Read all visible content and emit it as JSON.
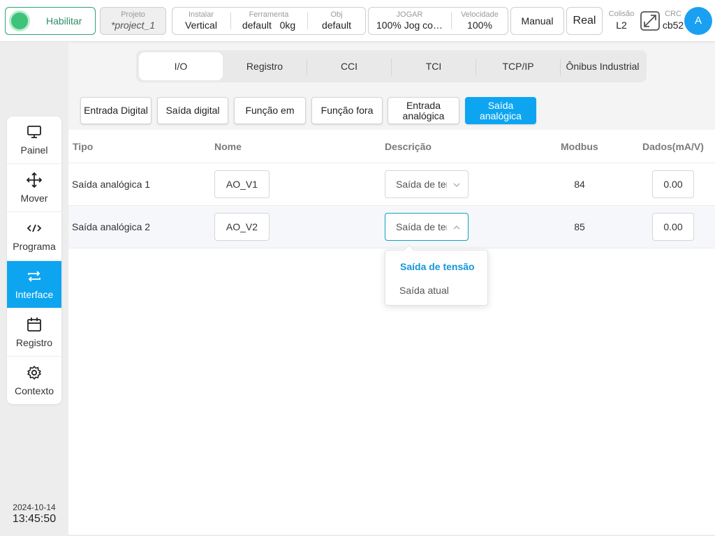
{
  "topbar": {
    "enable_label": "Habilitar",
    "project": {
      "label": "Projeto",
      "value": "*project_1"
    },
    "install": {
      "label": "Instalar",
      "value": "Vertical"
    },
    "tool": {
      "label": "Ferramenta",
      "value": "default",
      "weight": "0kg"
    },
    "obj": {
      "label": "Obj",
      "value": "default"
    },
    "jog": {
      "label": "JOGAR",
      "value": "100%  Jog co…"
    },
    "speed": {
      "label": "Velocidade",
      "value": "100%"
    },
    "manual_label": "Manual",
    "real_label": "Real",
    "collision": {
      "label": "Colisão",
      "value": "L2"
    },
    "crc": {
      "label": "CRC",
      "value": "cb52"
    },
    "avatar": "A"
  },
  "sidebar": {
    "items": [
      {
        "label": "Painel",
        "icon": "monitor-icon"
      },
      {
        "label": "Mover",
        "icon": "move-arrows-icon"
      },
      {
        "label": "Programa",
        "icon": "code-icon"
      },
      {
        "label": "Interface",
        "icon": "swap-arrows-icon",
        "active": true
      },
      {
        "label": "Registro",
        "icon": "calendar-icon"
      },
      {
        "label": "Contexto",
        "icon": "gear-icon"
      }
    ]
  },
  "datetime": {
    "date": "2024-10-14",
    "time": "13:45:50"
  },
  "tabs": [
    "I/O",
    "Registro",
    "CCI",
    "TCI",
    "TCP/IP",
    "Ônibus Industrial"
  ],
  "subtabs": [
    "Entrada Digital",
    "Saída digital",
    "Função em",
    "Função fora",
    "Entrada analógica",
    "Saída analógica"
  ],
  "table": {
    "headers": {
      "type": "Tipo",
      "name": "Nome",
      "desc": "Descrição",
      "modbus": "Modbus",
      "data": "Dados(mA/V)"
    },
    "rows": [
      {
        "type": "Saída analógica 1",
        "name": "AO_V1",
        "desc": "Saída de tensão",
        "modbus": "84",
        "data": "0.00"
      },
      {
        "type": "Saída analógica 2",
        "name": "AO_V2",
        "desc": "Saída de tensão",
        "modbus": "85",
        "data": "0.00"
      }
    ]
  },
  "dropdown": {
    "options": [
      "Saída de tensão",
      "Saída atual"
    ],
    "selected": "Saída de tensão"
  },
  "colors": {
    "accent": "#0ea5f0",
    "enable_green": "#3fc27a",
    "selected_text": "#1596d9"
  }
}
